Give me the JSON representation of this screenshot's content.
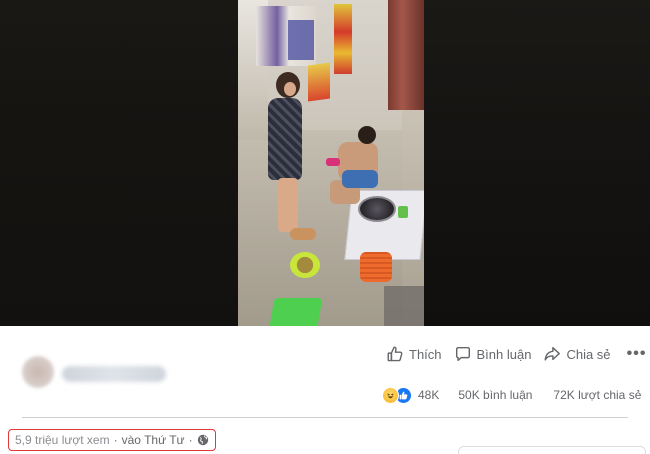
{
  "video": {
    "description_icon": "video-player"
  },
  "author": {
    "name": "",
    "avatar_icon": "avatar"
  },
  "actions": {
    "like_label": "Thích",
    "comment_label": "Bình luận",
    "share_label": "Chia sẻ",
    "more_label": "•••"
  },
  "stats": {
    "reactions": [
      "haha-icon",
      "like-icon"
    ],
    "reaction_count": "48K",
    "comments": "50K bình luận",
    "shares": "72K lượt chia sẻ"
  },
  "meta": {
    "views": "5,9 triệu lượt xem",
    "separator": "·",
    "time": "vào Thứ Tư",
    "dot": "·",
    "privacy_icon": "globe-icon"
  },
  "colors": {
    "accent": "#1877f2",
    "text_secondary": "#65676b",
    "highlight_border": "#e0393b",
    "haha_yellow": "#f7b125"
  }
}
